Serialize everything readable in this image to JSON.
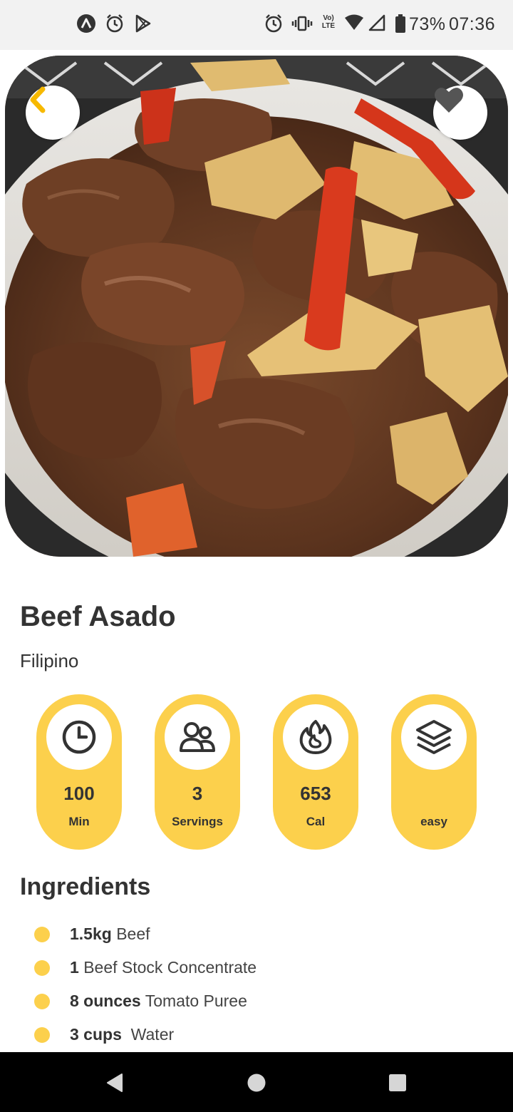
{
  "status_bar": {
    "battery": "73%",
    "time": "07:36",
    "volte_label": "Vo) LTE",
    "icons": [
      "app-a-icon",
      "alarm-icon",
      "play-store-icon",
      "alarm-icon",
      "vibrate-icon",
      "volte-icon",
      "wifi-icon",
      "signal-icon",
      "battery-icon"
    ]
  },
  "recipe": {
    "title": "Beef Asado",
    "cuisine": "Filipino"
  },
  "stats": [
    {
      "icon": "clock-icon",
      "value": "100",
      "unit": "Min"
    },
    {
      "icon": "people-icon",
      "value": "3",
      "unit": "Servings"
    },
    {
      "icon": "fire-icon",
      "value": "653",
      "unit": "Cal"
    },
    {
      "icon": "layers-icon",
      "value": "",
      "unit": "easy"
    }
  ],
  "ingredients": {
    "heading": "Ingredients",
    "items": [
      {
        "qty": "1.5kg",
        "name": "Beef"
      },
      {
        "qty": "1",
        "name": "Beef Stock Concentrate"
      },
      {
        "qty": "8 ounces",
        "name": "Tomato Puree"
      },
      {
        "qty": "3 cups",
        "name": " Water"
      }
    ]
  },
  "colors": {
    "accent": "#fcd04c",
    "back_arrow": "#f7b900",
    "heart": "#555555",
    "text": "#333333"
  },
  "nav": {
    "icons": [
      "back-triangle-icon",
      "home-circle-icon",
      "recents-square-icon"
    ]
  }
}
